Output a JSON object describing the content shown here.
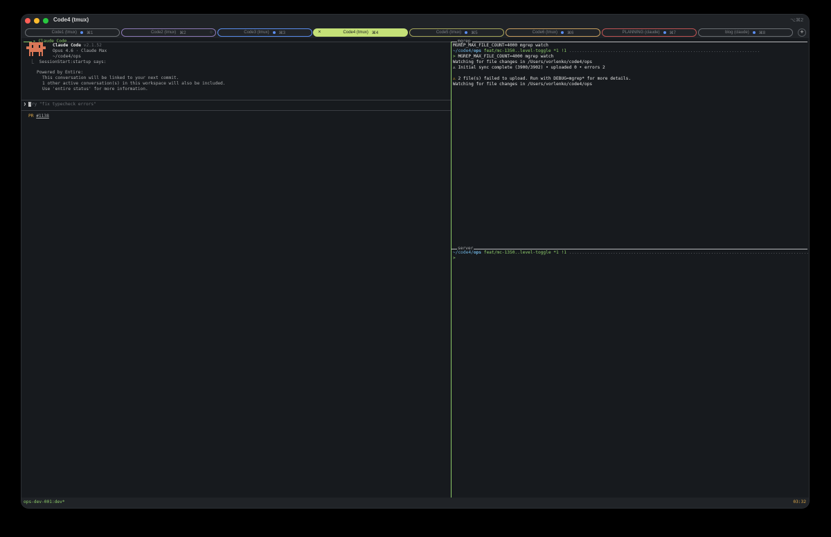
{
  "window": {
    "title": "Code4 (tmux)",
    "shortcut": "⌥⌘2",
    "traffic_lights": [
      "#ff5f57",
      "#febc2e",
      "#28c840"
    ]
  },
  "tabs": [
    {
      "label": "Code1 (tmux)",
      "shortcut": "⌘1",
      "indicator": "dot",
      "color": "#6b6f74"
    },
    {
      "label": "Code2 (tmux)",
      "shortcut": "⌘2",
      "indicator": "spinner",
      "color": "#8e7bb8"
    },
    {
      "label": "Code3 (tmux)",
      "shortcut": "⌘3",
      "indicator": "dot",
      "color": "#5b8def"
    },
    {
      "label": "Code4 (tmux)",
      "shortcut": "⌘4",
      "indicator": "close",
      "close_label": "×",
      "color": "#c5e178",
      "active": true
    },
    {
      "label": "Code5 (tmux)",
      "shortcut": "⌘5",
      "indicator": "dot",
      "color": "#a8a85c"
    },
    {
      "label": "Code6 (tmux)",
      "shortcut": "⌘6",
      "indicator": "dot",
      "color": "#c9a060"
    },
    {
      "label": "PLANNING (claude)",
      "shortcut": "⌘7",
      "indicator": "dot",
      "color": "#c05454"
    },
    {
      "label": "blog (claude)",
      "shortcut": "⌘8",
      "indicator": "dot",
      "color": "#6b6f74"
    }
  ],
  "new_tab_label": "+",
  "left_pane": {
    "header": "Claude Code",
    "product_name": "Claude Code",
    "version": "v2.1.52",
    "model_line": "Opus 4.6 · Claude Max",
    "cwd": "~/code4/ops",
    "hook_line": "⎿  SessionStart:startup says:",
    "powered_by": "Powered by Entire:",
    "info_lines": [
      "This conversation will be linked to your next commit.",
      "1 other active conversation(s) in this workspace will also be included.",
      "Use 'entire status' for more information."
    ],
    "prompt_symbol": "❯",
    "input_placeholder": "Try \"fix typecheck errors\"",
    "pr_label": "PR",
    "pr_number": "#1138"
  },
  "mgrep_pane": {
    "title": "mgrep",
    "lines": {
      "cmd1": "MGREP_MAX_FILE_COUNT=4000 mgrep watch",
      "path": "~/code4/",
      "dir": "ops",
      "branch": " feat/mc-1350..level-toggle *1 !1",
      "prompt": ">",
      "cmd2": " MGREP_MAX_FILE_COUNT=4000 mgrep watch",
      "watching1": "Watching for file changes in /Users/vorlenko/code4/ops",
      "sync": "⚠ Initial sync complete (3900/3902) • uploaded 0 • errors 2",
      "warn": " 2 file(s) failed to upload. Run with DEBUG=mgrep* for more details.",
      "watching2": "Watching for file changes in /Users/vorlenko/code4/ops"
    }
  },
  "server_pane": {
    "title": "server",
    "path": "~/code4/",
    "dir": "ops",
    "branch": " feat/mc-1350..level-toggle *1 !1",
    "prompt": ">"
  },
  "statusbar": {
    "session": "ops-dev-001:dev*",
    "time": "03:32"
  }
}
